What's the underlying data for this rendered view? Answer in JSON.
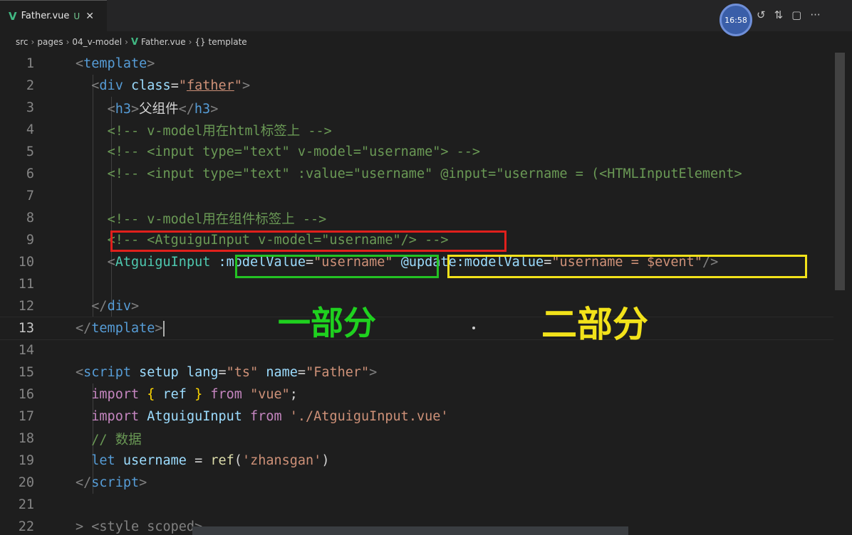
{
  "tab": {
    "filename": "Father.vue",
    "status": "U",
    "close": "✕"
  },
  "clock": "16:58",
  "tab_actions": [
    "↺",
    "⇅",
    "▢",
    "···"
  ],
  "breadcrumb": {
    "parts": [
      "src",
      "pages",
      "04_v-model",
      "Father.vue",
      "{} template"
    ]
  },
  "lines": [
    {
      "n": "1"
    },
    {
      "n": "2"
    },
    {
      "n": "3"
    },
    {
      "n": "4"
    },
    {
      "n": "5"
    },
    {
      "n": "6"
    },
    {
      "n": "7"
    },
    {
      "n": "8"
    },
    {
      "n": "9"
    },
    {
      "n": "10"
    },
    {
      "n": "11"
    },
    {
      "n": "12"
    },
    {
      "n": "13"
    },
    {
      "n": "14"
    },
    {
      "n": "15"
    },
    {
      "n": "16"
    },
    {
      "n": "17"
    },
    {
      "n": "18"
    },
    {
      "n": "19"
    },
    {
      "n": "20"
    },
    {
      "n": "21"
    },
    {
      "n": "22"
    }
  ],
  "code": {
    "l3_text": "父组件",
    "l4": "<!-- v-model用在html标签上 -->",
    "l5": "<!-- <input type=\"text\" v-model=\"username\"> -->",
    "l6": "<!-- <input type=\"text\" :value=\"username\" @input=\"username = (<HTMLInputElement>",
    "l8": "<!-- v-model用在组件标签上 -->",
    "l9": "<!-- <AtguiguInput v-model=\"username\"/> -->",
    "l10_attr1": ":modelValue",
    "l10_val1": "\"username\"",
    "l10_attr2": "@update:modelValue",
    "l10_val2": "\"username = $event\"",
    "l15_lang": "\"ts\"",
    "l15_name": "\"Father\"",
    "l16_mod": "\"vue\"",
    "l17_path": "'./AtguiguInput.vue'",
    "l18": "// 数据",
    "l19_str": "'zhansgan'"
  },
  "annotations": {
    "part1": "一部分",
    "part2": "二部分"
  }
}
